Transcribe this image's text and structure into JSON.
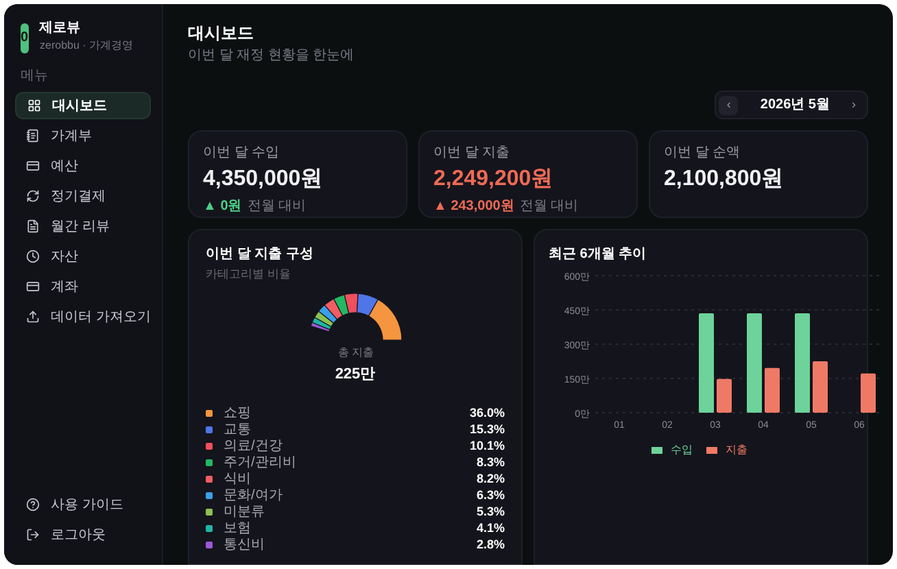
{
  "sidebar": {
    "logo": "0",
    "app_name": "제로뷰",
    "app_subtitle": "zerobbu · 가계경영",
    "section_label": "메뉴",
    "items": [
      {
        "label": "대시보드",
        "selected": true
      },
      {
        "label": "가계부",
        "selected": false
      },
      {
        "label": "예산",
        "selected": false
      },
      {
        "label": "정기결제",
        "selected": false
      },
      {
        "label": "월간 리뷰",
        "selected": false
      },
      {
        "label": "자산",
        "selected": false
      },
      {
        "label": "계좌",
        "selected": false
      },
      {
        "label": "데이터 가져오기",
        "selected": false
      }
    ],
    "footer_items": [
      {
        "label": "사용 가이드"
      },
      {
        "label": "로그아웃"
      }
    ]
  },
  "header": {
    "title": "대시보드",
    "subtitle": "이번 달 재정 현황을 한눈에"
  },
  "month_picker": {
    "prev": "‹",
    "value": "2026년 5월",
    "next": "›"
  },
  "summary_cards": [
    {
      "kind": "income",
      "label": "이번 달 수입",
      "value": "4,350,000원",
      "change": {
        "arrow": "▲",
        "amount": "0원",
        "note": "전월 대비"
      }
    },
    {
      "kind": "expense",
      "label": "이번 달 지출",
      "value": "2,249,200원",
      "change": {
        "arrow": "▲",
        "amount": "243,000원",
        "note": "전월 대비"
      }
    },
    {
      "kind": "net",
      "label": "이번 달 순액",
      "value": "2,100,800원"
    }
  ],
  "expense_breakdown": {
    "title": "이번 달 지출 구성",
    "subtitle": "카테고리별 비율",
    "center_label": "총 지출",
    "center_value": "225만",
    "categories": [
      {
        "name": "쇼핑",
        "percent": "36.0%",
        "color": "#f5953f"
      },
      {
        "name": "교통",
        "percent": "15.3%",
        "color": "#4f76e8"
      },
      {
        "name": "의료/건강",
        "percent": "10.1%",
        "color": "#ef4f5e"
      },
      {
        "name": "주거/관리비",
        "percent": "8.3%",
        "color": "#22b863"
      },
      {
        "name": "식비",
        "percent": "8.2%",
        "color": "#f25c63"
      },
      {
        "name": "문화/여가",
        "percent": "6.3%",
        "color": "#3aa0e8"
      },
      {
        "name": "미분류",
        "percent": "5.3%",
        "color": "#8cc152"
      },
      {
        "name": "보험",
        "percent": "4.1%",
        "color": "#1fb5a5"
      },
      {
        "name": "통신비",
        "percent": "2.8%",
        "color": "#9b59d6"
      }
    ]
  },
  "trend": {
    "title": "최근 6개월 추이",
    "chart_data": {
      "type": "bar",
      "grid": true,
      "categories": [
        "01",
        "02",
        "03",
        "04",
        "05",
        "06"
      ],
      "ylim": [
        0,
        600
      ],
      "yticks": [
        {
          "value": 0,
          "label": "0만"
        },
        {
          "value": 150,
          "label": "150만"
        },
        {
          "value": 300,
          "label": "300만"
        },
        {
          "value": 450,
          "label": "450만"
        },
        {
          "value": 600,
          "label": "600만"
        }
      ],
      "series": [
        {
          "name": "수입",
          "color": "#6dd39a",
          "values": [
            null,
            null,
            435,
            435,
            435,
            null
          ]
        },
        {
          "name": "지출",
          "color": "#ee7a66",
          "values": [
            null,
            null,
            148,
            196,
            225,
            172
          ]
        }
      ]
    }
  }
}
